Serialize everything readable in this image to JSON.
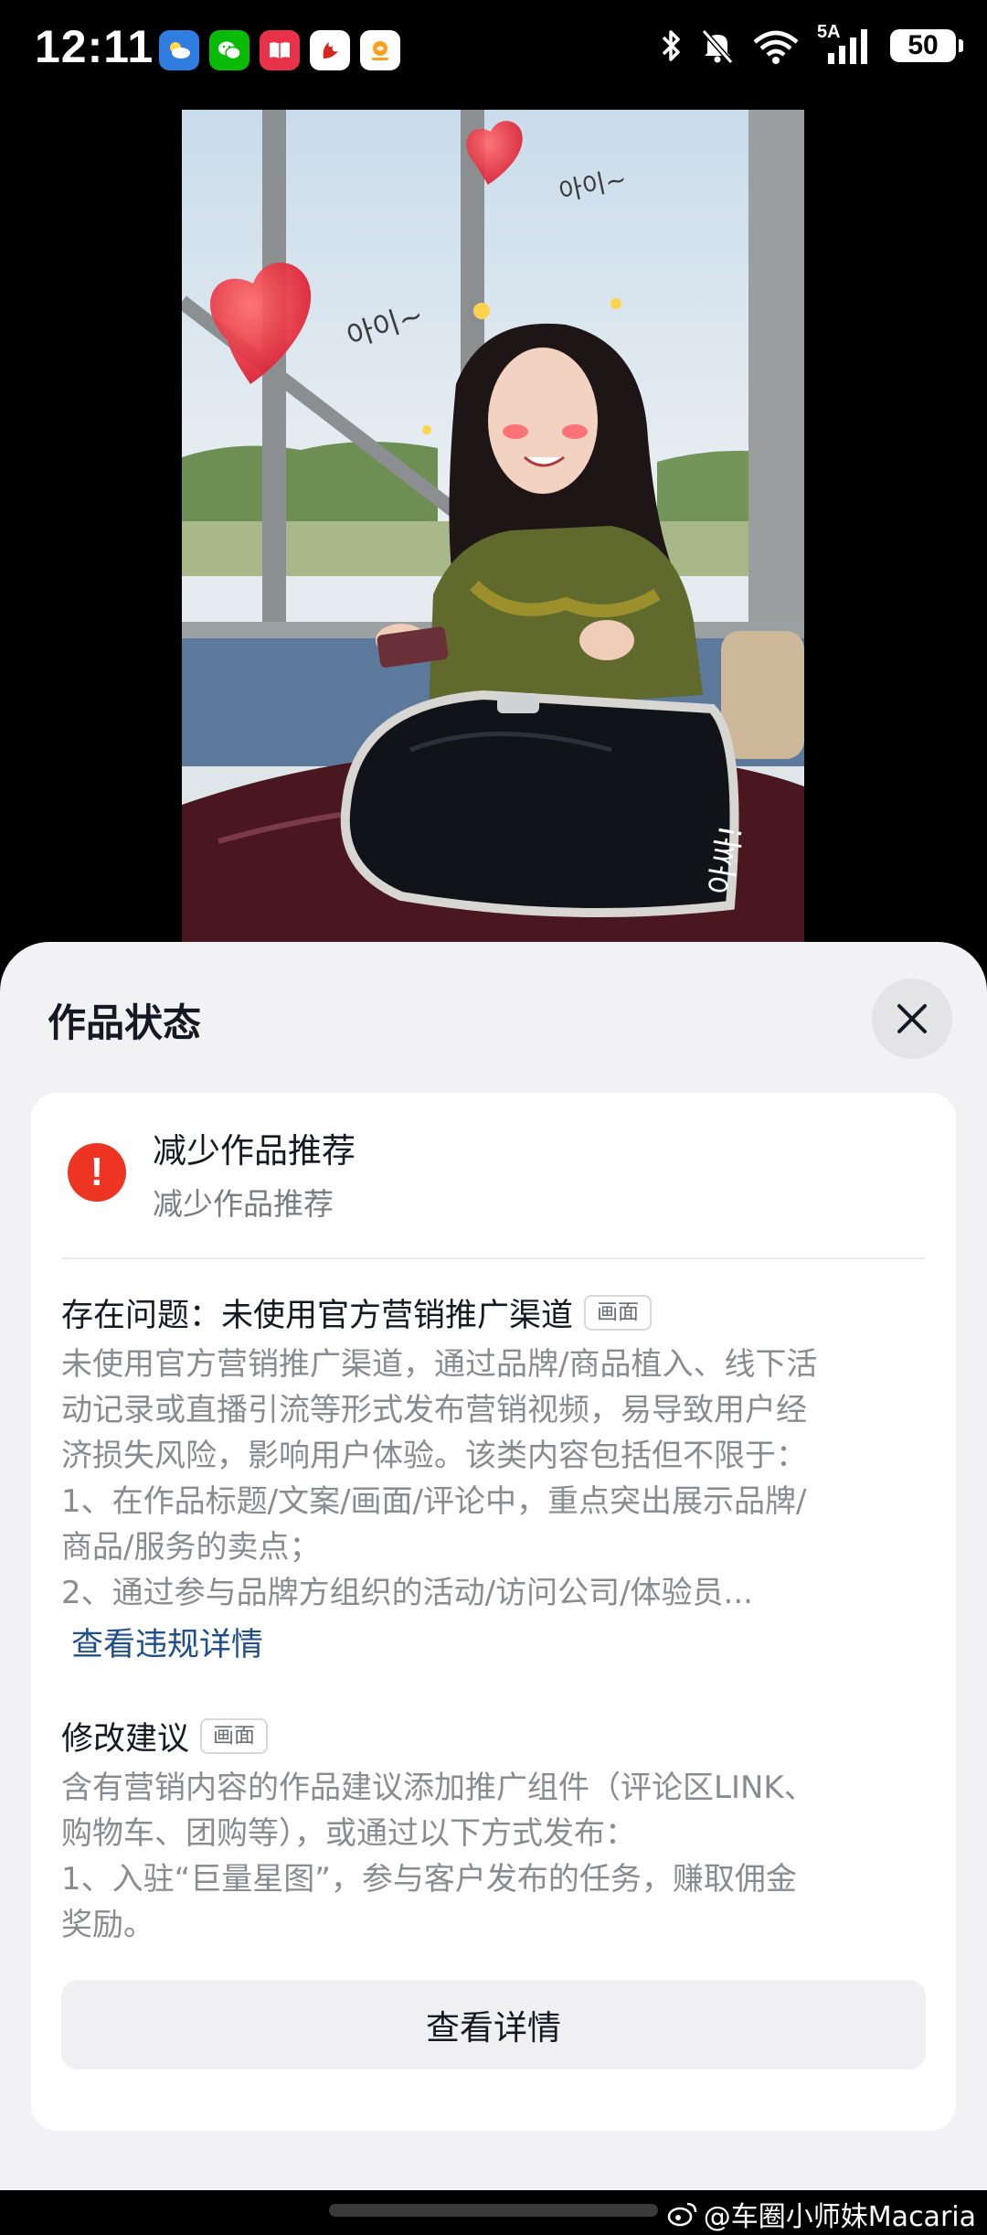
{
  "status_bar": {
    "time": "12:11",
    "network": "5A",
    "battery": "50",
    "app_icons": [
      "weather-icon",
      "wechat-icon",
      "book-icon",
      "air-china-icon",
      "mini-app-icon"
    ]
  },
  "sheet": {
    "title": "作品状态",
    "status_title": "减少作品推荐",
    "status_sub": "减少作品推荐",
    "issue": {
      "title": "存在问题：未使用官方营销推广渠道",
      "tag": "画面",
      "lines": [
        "未使用官方营销推广渠道，通过品牌/商品植入、线下活",
        "动记录或直播引流等形式发布营销视频，易导致用户经",
        "济损失风险，影响用户体验。该类内容包括但不限于：",
        "1、在作品标题/文案/画面/评论中，重点突出展示品牌/",
        "商品/服务的卖点；",
        "2、通过参与品牌方组织的活动/访问公司/体验员..."
      ],
      "link": "查看违规详情"
    },
    "suggestion": {
      "title": "修改建议",
      "tag": "画面",
      "lines": [
        "含有营销内容的作品建议添加推广组件（评论区LINK、",
        "购物车、团购等），或通过以下方式发布：",
        "1、入驻“巨量星图”，参与客户发布的任务，赚取佣金",
        "奖励。"
      ]
    },
    "detail_button": "查看详情"
  },
  "watermark": "@车圈小师妹Macaria",
  "colors": {
    "warning": "#ee3524",
    "link": "#1f4e8c",
    "sheet_bg": "#f2f2f4"
  }
}
